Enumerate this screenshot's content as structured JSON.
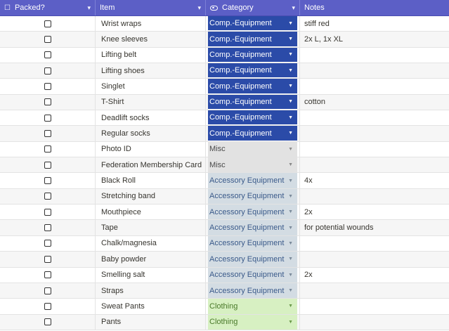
{
  "header": {
    "packed": "Packed?",
    "item": "Item",
    "category": "Category",
    "notes": "Notes"
  },
  "colors": {
    "header_bg": "#5c5fc6",
    "comp_equipment": "#2b4ba8",
    "misc": "#e2e2e2",
    "accessory_equipment": "#d3dce3",
    "clothing": "#d7f0c2"
  },
  "rows": [
    {
      "packed": false,
      "item": "Wrist wraps",
      "category": "Comp.-Equipment",
      "cat": "comp",
      "notes": "stiff red"
    },
    {
      "packed": false,
      "item": "Knee sleeves",
      "category": "Comp.-Equipment",
      "cat": "comp",
      "notes": "2x L, 1x XL"
    },
    {
      "packed": false,
      "item": "Lifting belt",
      "category": "Comp.-Equipment",
      "cat": "comp",
      "notes": ""
    },
    {
      "packed": false,
      "item": "Lifting shoes",
      "category": "Comp.-Equipment",
      "cat": "comp",
      "notes": ""
    },
    {
      "packed": false,
      "item": "Singlet",
      "category": "Comp.-Equipment",
      "cat": "comp",
      "notes": ""
    },
    {
      "packed": false,
      "item": "T-Shirt",
      "category": "Comp.-Equipment",
      "cat": "comp",
      "notes": "cotton"
    },
    {
      "packed": false,
      "item": "Deadlift socks",
      "category": "Comp.-Equipment",
      "cat": "comp",
      "notes": ""
    },
    {
      "packed": false,
      "item": "Regular socks",
      "category": "Comp.-Equipment",
      "cat": "comp",
      "notes": ""
    },
    {
      "packed": false,
      "item": "Photo ID",
      "category": "Misc",
      "cat": "misc",
      "notes": ""
    },
    {
      "packed": false,
      "item": "Federation Membership Card",
      "category": "Misc",
      "cat": "misc",
      "notes": ""
    },
    {
      "packed": false,
      "item": "Black Roll",
      "category": "Accessory Equipment",
      "cat": "acc",
      "notes": "4x"
    },
    {
      "packed": false,
      "item": "Stretching band",
      "category": "Accessory Equipment",
      "cat": "acc",
      "notes": ""
    },
    {
      "packed": false,
      "item": "Mouthpiece",
      "category": "Accessory Equipment",
      "cat": "acc",
      "notes": "2x"
    },
    {
      "packed": false,
      "item": "Tape",
      "category": "Accessory Equipment",
      "cat": "acc",
      "notes": "for potential wounds"
    },
    {
      "packed": false,
      "item": "Chalk/magnesia",
      "category": "Accessory Equipment",
      "cat": "acc",
      "notes": ""
    },
    {
      "packed": false,
      "item": "Baby powder",
      "category": "Accessory Equipment",
      "cat": "acc",
      "notes": ""
    },
    {
      "packed": false,
      "item": "Smelling salt",
      "category": "Accessory Equipment",
      "cat": "acc",
      "notes": "2x"
    },
    {
      "packed": false,
      "item": "Straps",
      "category": "Accessory Equipment",
      "cat": "acc",
      "notes": ""
    },
    {
      "packed": false,
      "item": "Sweat Pants",
      "category": "Clothing",
      "cat": "cloth",
      "notes": ""
    },
    {
      "packed": false,
      "item": "Pants",
      "category": "Clothing",
      "cat": "cloth",
      "notes": ""
    }
  ]
}
